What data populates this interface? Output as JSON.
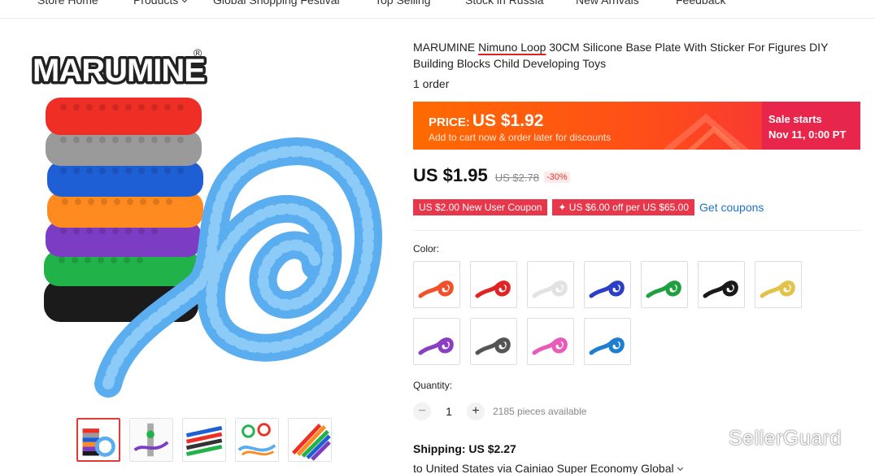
{
  "nav": {
    "items": [
      "Store Home",
      "Products",
      "Global Shopping Festival",
      "Top Selling",
      "Stock in Russia",
      "New Arrivals",
      "Feedback"
    ]
  },
  "gallery": {
    "brand_logo": "MARUMINE",
    "brand_mark": "®"
  },
  "product": {
    "title_pre": "MARUMINE ",
    "title_highlight": "Nimuno Loop",
    "title_post": " 30CM Silicone Base Plate With Sticker For Figures DIY Building Blocks Child Developing Toys",
    "orders": "1 order"
  },
  "price_banner": {
    "label": "PRICE:",
    "value": "US $1.92",
    "subtext": "Add to cart now & order later for discounts",
    "sale_line1": "Sale starts",
    "sale_line2": "Nov 11, 0:00 PT"
  },
  "pricing": {
    "current": "US $1.95",
    "original": "US $2.78",
    "discount": "-30%"
  },
  "coupons": {
    "coupon1": "US $2.00 New User Coupon",
    "coupon2": "✦ US $6.00 off per US $65.00",
    "get_coupons": "Get coupons"
  },
  "color": {
    "label": "Color:",
    "swatches": [
      "#f0502a",
      "#e02424",
      "#eaeaea",
      "#2b3fc6",
      "#1fa040",
      "#1a1a1a",
      "#e3c24a",
      "#8a3fc2",
      "#555555",
      "#e85bb8",
      "#1e7ed0"
    ]
  },
  "quantity": {
    "label": "Quantity:",
    "value": "1",
    "minus": "−",
    "plus": "+",
    "available": "2185 pieces available"
  },
  "shipping": {
    "cost": "Shipping: US $2.27",
    "to": "to United States via Cainiao Super Economy Global"
  },
  "watermark": {
    "text": "SellerGuard"
  }
}
